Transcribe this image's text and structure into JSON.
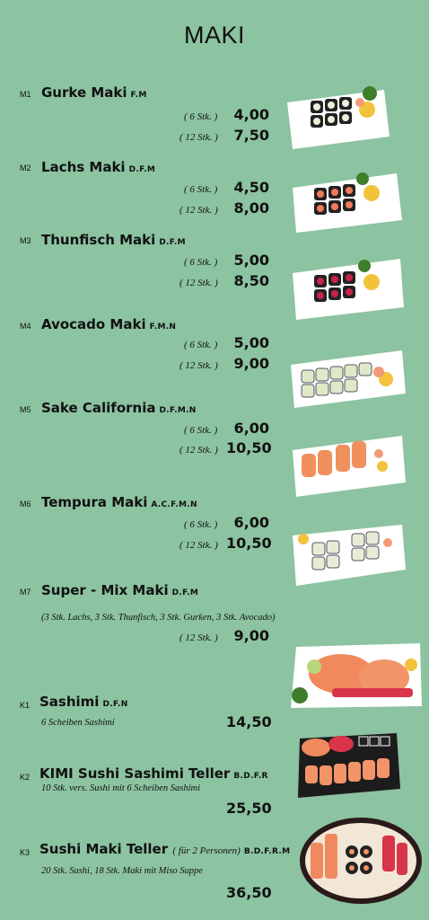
{
  "title": "MAKI",
  "items": [
    {
      "code": "M1",
      "name": "Gurke Maki",
      "allergens": "F.M",
      "q1": "( 6 Stk. )",
      "p1": "4,00",
      "q2": "( 12 Stk. )",
      "p2": "7,50"
    },
    {
      "code": "M2",
      "name": "Lachs Maki",
      "allergens": "D.F.M",
      "q1": "( 6 Stk. )",
      "p1": "4,50",
      "q2": "( 12 Stk. )",
      "p2": "8,00"
    },
    {
      "code": "M3",
      "name": "Thunfisch Maki",
      "allergens": "D.F.M",
      "q1": "( 6 Stk. )",
      "p1": "5,00",
      "q2": "( 12 Stk. )",
      "p2": "8,50"
    },
    {
      "code": "M4",
      "name": "Avocado Maki",
      "allergens": "F.M.N",
      "q1": "( 6 Stk. )",
      "p1": "5,00",
      "q2": "( 12 Stk. )",
      "p2": "9,00"
    },
    {
      "code": "M5",
      "name": "Sake California",
      "allergens": "D.F.M.N",
      "q1": "( 6 Stk. )",
      "p1": "6,00",
      "q2": "( 12 Stk. )",
      "p2": "10,50"
    },
    {
      "code": "M6",
      "name": "Tempura Maki",
      "allergens": "A.C.F.M.N",
      "q1": "( 6 Stk. )",
      "p1": "6,00",
      "q2": "( 12 Stk. )",
      "p2": "10,50"
    },
    {
      "code": "M7",
      "name": "Super - Mix Maki",
      "allergens": "D.F.M",
      "desc": "(3 Stk. Lachs, 3 Stk. Thunfisch, 3 Stk. Gurken, 3 Stk. Avocado)",
      "q1": "( 12 Stk. )",
      "p1": "9,00"
    },
    {
      "code": "K1",
      "name": "Sashimi",
      "allergens": "D.F.N",
      "desc": "6 Scheiben Sashimi",
      "p1": "14,50"
    },
    {
      "code": "K2",
      "name": "KIMI Sushi Sashimi Teller",
      "allergens": "B.D.F.R",
      "desc": "10 Stk. vers. Sushi mit 6 Scheiben Sashimi",
      "p1": "25,50"
    },
    {
      "code": "K3",
      "name": "Sushi Maki Teller",
      "persons": "( für 2 Personen)",
      "allergens": "B.D.F.R.M",
      "desc": "20 Stk. Sushi, 18 Stk. Maki mit Miso Suppe",
      "p1": "36,50"
    }
  ],
  "colors": {
    "background": "#8cc3a1",
    "text": "#111111"
  }
}
